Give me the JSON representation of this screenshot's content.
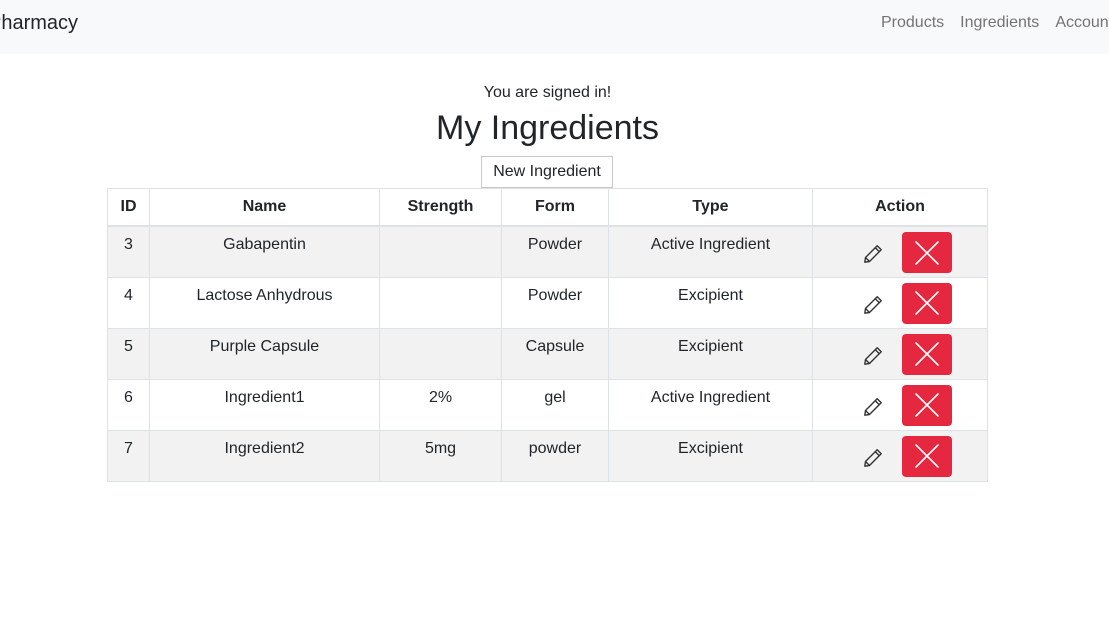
{
  "nav": {
    "brand": "Pharmacy",
    "links": [
      "Products",
      "Ingredients",
      "Account"
    ]
  },
  "main": {
    "status": "You are signed in!",
    "title": "My Ingredients",
    "new_button": "New Ingredient"
  },
  "table": {
    "headers": [
      "ID",
      "Name",
      "Strength",
      "Form",
      "Type",
      "Action"
    ],
    "rows": [
      {
        "id": "3",
        "name": "Gabapentin",
        "strength": "",
        "form": "Powder",
        "type": "Active Ingredient"
      },
      {
        "id": "4",
        "name": "Lactose Anhydrous",
        "strength": "",
        "form": "Powder",
        "type": "Excipient"
      },
      {
        "id": "5",
        "name": "Purple Capsule",
        "strength": "",
        "form": "Capsule",
        "type": "Excipient"
      },
      {
        "id": "6",
        "name": "Ingredient1",
        "strength": "2%",
        "form": "gel",
        "type": "Active Ingredient"
      },
      {
        "id": "7",
        "name": "Ingredient2",
        "strength": "5mg",
        "form": "powder",
        "type": "Excipient"
      }
    ],
    "row_actions": [
      {
        "icon": "pencil-icon",
        "name": "edit-button"
      },
      {
        "icon": "close-icon",
        "name": "delete-button"
      }
    ]
  },
  "colors": {
    "navbar_bg": "#f8f9fa",
    "delete_button": "#e5273f",
    "stripe": "#f2f2f2",
    "nav_link": "#737373"
  }
}
